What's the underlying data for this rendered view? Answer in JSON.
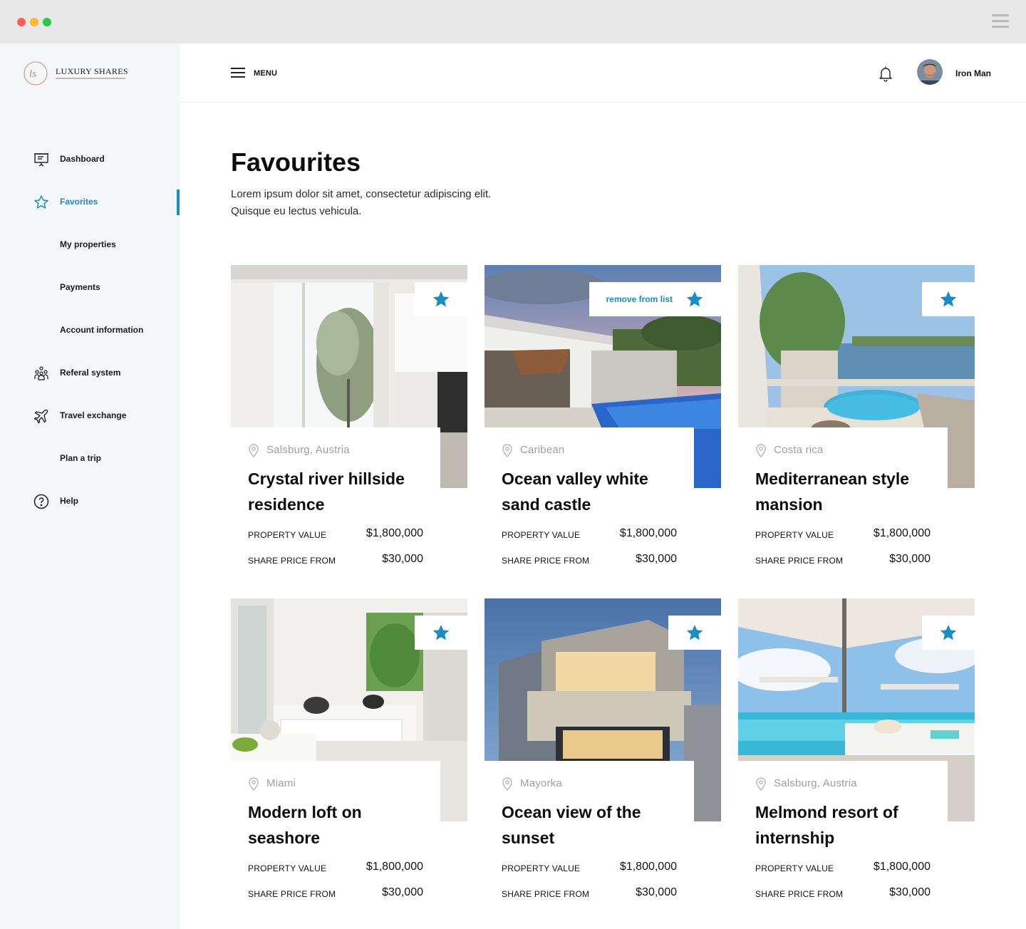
{
  "window": {
    "controls": [
      "close",
      "minimize",
      "maximize"
    ]
  },
  "brand": {
    "logo_text": "LUXURY SHARES",
    "logo_monogram": "ls"
  },
  "sidebar": {
    "items": [
      {
        "label": "Dashboard",
        "icon": "presentation-board-icon",
        "active": false
      },
      {
        "label": "Favorites",
        "icon": "star-outline-icon",
        "active": true
      },
      {
        "label": "My properties",
        "icon": "",
        "active": false
      },
      {
        "label": "Payments",
        "icon": "",
        "active": false
      },
      {
        "label": "Account information",
        "icon": "",
        "active": false
      },
      {
        "label": "Referal system",
        "icon": "people-group-icon",
        "active": false
      },
      {
        "label": "Travel exchange",
        "icon": "airplane-icon",
        "active": false
      },
      {
        "label": "Plan a trip",
        "icon": "",
        "active": false
      },
      {
        "label": "Help",
        "icon": "question-circle-icon",
        "active": false
      }
    ]
  },
  "header": {
    "menu_label": "MENU",
    "user_name": "Iron Man"
  },
  "page": {
    "title": "Favourites",
    "description_line1": "Lorem ipsum dolor sit amet, consectetur adipiscing elit.",
    "description_line2": "Quisque eu lectus vehicula."
  },
  "labels": {
    "property_value": "PROPERTY VALUE",
    "share_price_from": "SHARE PRICE FROM",
    "remove_from_list": "remove from list"
  },
  "cards": [
    {
      "location": "Salsburg, Austria",
      "title": "Crystal river hillside residence",
      "property_value": "$1,800,000",
      "share_price": "$30,000",
      "hover": false
    },
    {
      "location": "Caribean",
      "title": "Ocean valley white sand castle",
      "property_value": "$1,800,000",
      "share_price": "$30,000",
      "hover": true
    },
    {
      "location": "Costa rica",
      "title": "Mediterranean style mansion",
      "property_value": "$1,800,000",
      "share_price": "$30,000",
      "hover": false
    },
    {
      "location": "Miami",
      "title": "Modern loft on seashore",
      "property_value": "$1,800,000",
      "share_price": "$30,000",
      "hover": false
    },
    {
      "location": "Mayorka",
      "title": "Ocean view of the sunset",
      "property_value": "$1,800,000",
      "share_price": "$30,000",
      "hover": false
    },
    {
      "location": "Salsburg, Austria",
      "title": "Melmond resort of internship",
      "property_value": "$1,800,000",
      "share_price": "$30,000",
      "hover": false
    }
  ],
  "colors": {
    "accent": "#1a8dc4",
    "sidebar_bg": "#f5f6fa",
    "muted_text": "#9ca0a6"
  }
}
